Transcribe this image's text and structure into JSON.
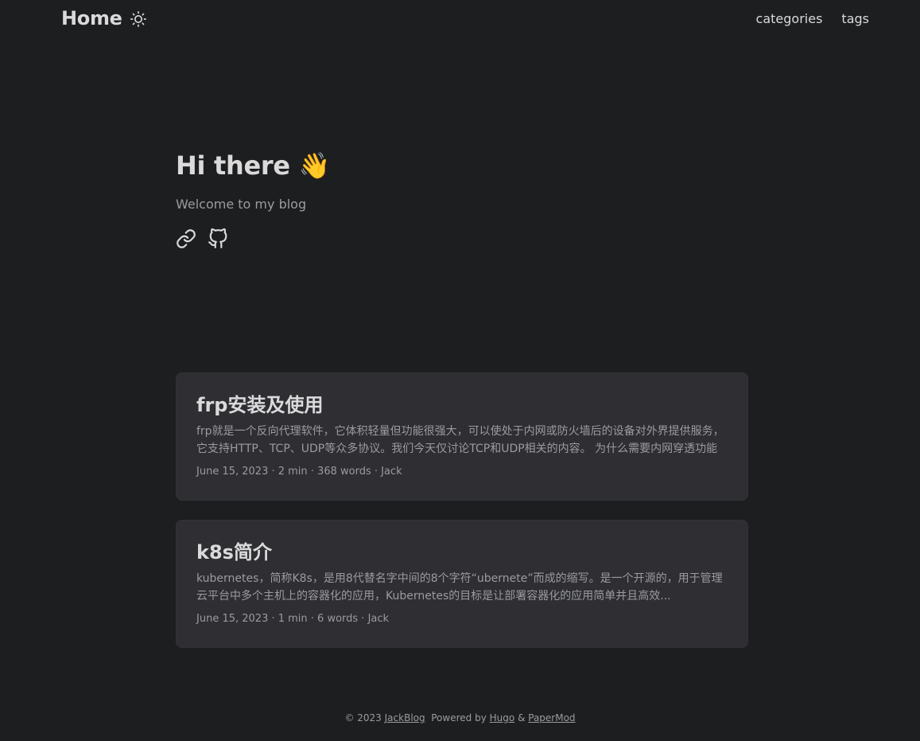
{
  "header": {
    "logo": "Home",
    "theme_icon": "sun-icon",
    "menu": [
      {
        "label": "categories"
      },
      {
        "label": "tags"
      }
    ]
  },
  "home": {
    "title": "Hi there 👋",
    "subtitle": "Welcome to my blog",
    "social_icons": [
      "link-icon",
      "github-icon"
    ]
  },
  "posts": [
    {
      "title": "frp安装及使用",
      "excerpt": "frp就是一个反向代理软件，它体积轻量但功能很强大，可以使处于内网或防火墙后的设备对外界提供服务，它支持HTTP、TCP、UDP等众多协议。我们今天仅讨论TCP和UDP相关的内容。 为什么需要内网穿透功能 从...",
      "meta": "June 15, 2023 · 2 min · 368 words · Jack"
    },
    {
      "title": "k8s简介",
      "excerpt": "kubernetes，简称K8s，是用8代替名字中间的8个字符“ubernete”而成的缩写。是一个开源的，用于管理云平台中多个主机上的容器化的应用，Kubernetes的目标是让部署容器化的应用简单并且高效...",
      "meta": "June 15, 2023 · 1 min · 6 words · Jack"
    }
  ],
  "footer": {
    "copyright": "© 2023",
    "site_link": "JackBlog",
    "powered": "Powered by",
    "hugo_link": "Hugo",
    "amp": "&",
    "theme_link": "PaperMod"
  }
}
